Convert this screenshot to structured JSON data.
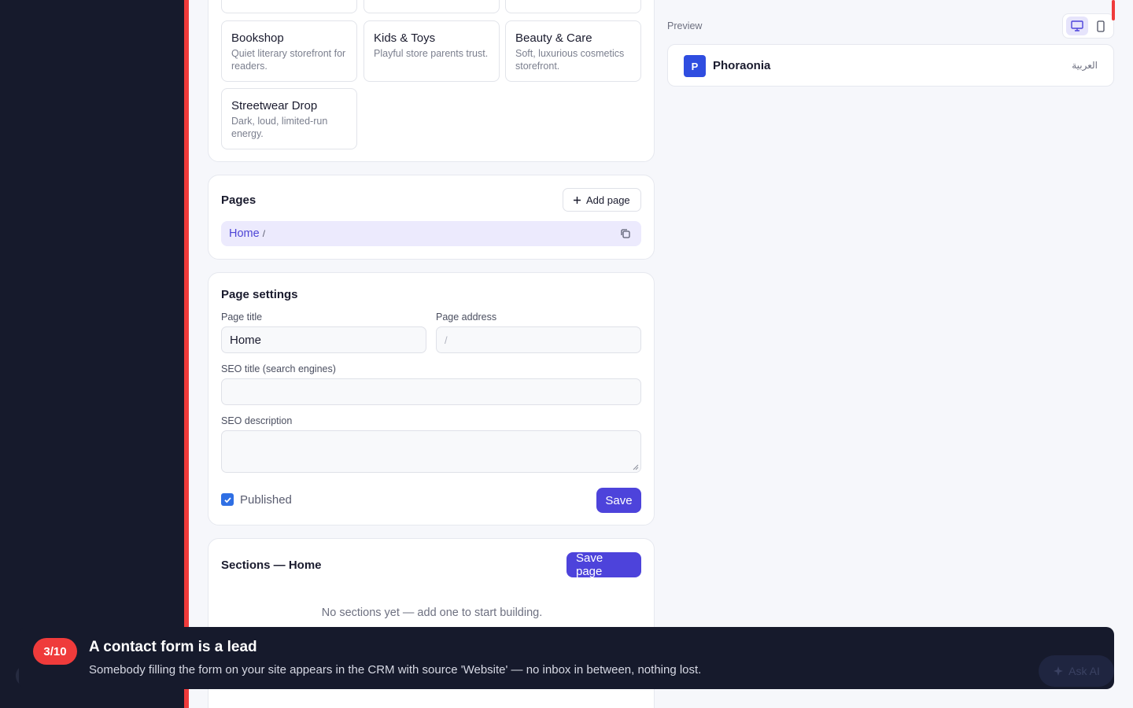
{
  "templates": [
    {
      "name": "Bookshop",
      "desc": "Quiet literary storefront for readers."
    },
    {
      "name": "Kids & Toys",
      "desc": "Playful store parents trust."
    },
    {
      "name": "Beauty & Care",
      "desc": "Soft, luxurious cosmetics storefront."
    },
    {
      "name": "Streetwear Drop",
      "desc": "Dark, loud, limited-run energy."
    }
  ],
  "pages": {
    "title": "Pages",
    "add_label": "Add page",
    "items": [
      {
        "name": "Home",
        "path": "/"
      }
    ]
  },
  "settings": {
    "title": "Page settings",
    "page_title_label": "Page title",
    "page_title_value": "Home",
    "page_address_label": "Page address",
    "page_address_placeholder": "/",
    "seo_title_label": "SEO title (search engines)",
    "seo_description_label": "SEO description",
    "published_label": "Published",
    "published": true,
    "save_label": "Save"
  },
  "sections": {
    "title": "Sections — Home",
    "save_label": "Save page",
    "empty_text": "No sections yet — add one to start building."
  },
  "preview": {
    "label": "Preview",
    "brand": "Phoraonia",
    "logo_letter": "P",
    "language": "العربية"
  },
  "toast": {
    "step": "3/10",
    "title": "A contact form is a lead",
    "body": "Somebody filling the form on your site appears in the CRM with source 'Website' — no inbox in between, nothing lost.",
    "ask_ai": "Ask AI"
  },
  "colors": {
    "accent": "#4d43db",
    "danger": "#ef3b3b",
    "sidebar": "#161a2c"
  }
}
